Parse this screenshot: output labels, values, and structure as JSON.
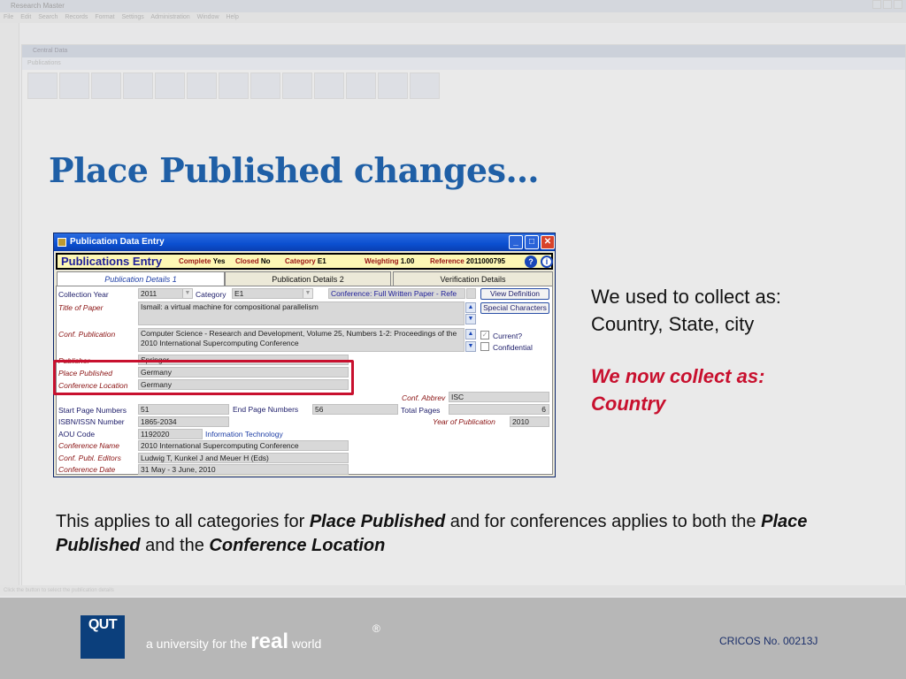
{
  "background_app": {
    "title": "Research Master",
    "menu": "File Edit Search Records Format Settings Administration Window Help",
    "inner_title": "Central Data",
    "inner_bar": "Publications",
    "status_text": "Click the button to select the publication details"
  },
  "slide": {
    "title": "Place Published changes…",
    "collect_old_line1": "We used to collect as:",
    "collect_old_line2": "Country, State, city",
    "collect_new_line1": "We now collect as:",
    "collect_new_line2": "Country",
    "note_part1": "This applies to all categories for ",
    "note_em1": "Place Published",
    "note_part2": " and for conferences applies to both the ",
    "note_em2": "Place Published",
    "note_part3": " and the ",
    "note_em3": "Conference Location",
    "highlight_color": "#c8102e"
  },
  "dialog": {
    "title": "Publication Data Entry",
    "header": {
      "title": "Publications Entry",
      "complete_label": "Complete",
      "complete_value": "Yes",
      "closed_label": "Closed",
      "closed_value": "No",
      "category_label": "Category",
      "category_value": "E1",
      "weighting_label": "Weighting",
      "weighting_value": "1.00",
      "reference_label": "Reference",
      "reference_value": "2011000795"
    },
    "tabs": [
      "Publication Details 1",
      "Publication Details 2",
      "Verification Details"
    ],
    "labels": {
      "collection_year": "Collection Year",
      "category": "Category",
      "title_of_paper": "Title of Paper",
      "conf_publication": "Conf. Publication",
      "publisher": "Publisher",
      "place_published": "Place Published",
      "conference_location": "Conference Location",
      "conf_abbrev": "Conf. Abbrev",
      "start_page": "Start Page Numbers",
      "end_page": "End Page Numbers",
      "total_pages": "Total Pages",
      "isbn": "ISBN/ISSN Number",
      "year_of_publication": "Year of Publication",
      "aou_code": "AOU Code",
      "conference_name": "Conference Name",
      "conf_publ_editors": "Conf. Publ. Editors",
      "conference_date": "Conference Date"
    },
    "values": {
      "collection_year": "2011",
      "category": "E1",
      "category_desc": "Conference: Full Written Paper - Refe",
      "title_of_paper": "Ismail: a virtual machine for compositional parallelism",
      "conf_publication": "Computer Science - Research and Development, Volume 25, Numbers 1-2: Proceedings of the 2010 International Supercomputing Conference",
      "publisher": "Springer",
      "place_published": "Germany",
      "conference_location": "Germany",
      "conf_abbrev": "ISC",
      "start_page": "51",
      "end_page": "56",
      "total_pages": "6",
      "isbn": "1865-2034",
      "year_of_publication": "2010",
      "aou_code": "1192020",
      "aou_desc": "Information Technology",
      "conference_name": "2010 International Supercomputing Conference",
      "conf_publ_editors": "Ludwig T, Kunkel J and Meuer H (Eds)",
      "conference_date": "31 May - 3 June, 2010"
    },
    "buttons": {
      "view_definition": "View Definition",
      "special_characters": "Special Characters"
    },
    "checkboxes": {
      "current": "Current?",
      "current_checked": true,
      "confidential": "Confidential",
      "confidential_checked": false
    }
  },
  "footer": {
    "logo": "QUT",
    "tagline_prefix": "a university for the ",
    "tagline_real": "real",
    "tagline_world": " world",
    "registered": "®",
    "cricos": "CRICOS No. 00213J",
    "bg_color": "#b7b7b7",
    "logo_color": "#0b3f7c"
  }
}
